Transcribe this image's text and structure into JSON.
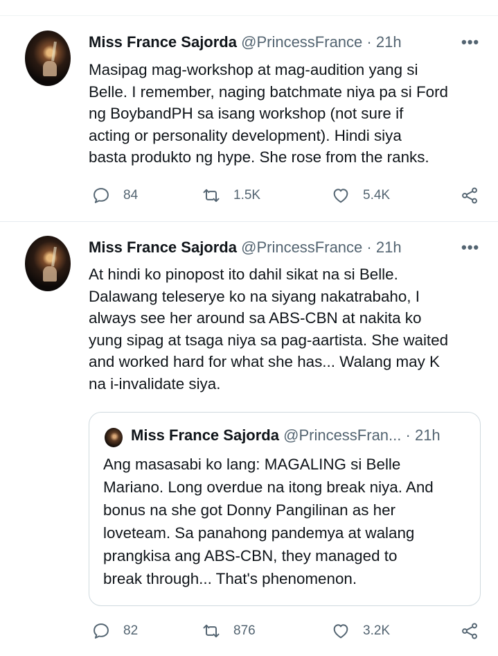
{
  "tweets": [
    {
      "author_name": "Miss France Sajorda",
      "handle": "@PrincessFrance",
      "separator": "·",
      "time": "21h",
      "more": "•••",
      "text_lines": [
        "Masipag mag-workshop at mag-audition yang si",
        "Belle. I remember, naging batchmate niya pa si Ford",
        "ng BoybandPH sa isang workshop (not sure if",
        "acting or personality development). Hindi siya",
        "basta produkto ng hype. She rose from the ranks."
      ],
      "replies": "84",
      "retweets": "1.5K",
      "likes": "5.4K"
    },
    {
      "author_name": "Miss France Sajorda",
      "handle": "@PrincessFrance",
      "separator": "·",
      "time": "21h",
      "more": "•••",
      "text_lines": [
        "At hindi ko pinopost ito dahil sikat na si Belle.",
        "Dalawang teleserye ko na siyang nakatrabaho, I",
        "always see her around sa ABS-CBN at nakita ko",
        "yung sipag at tsaga niya sa pag-aartista. She waited",
        "and worked hard for what she has... Walang may K",
        "na i-invalidate siya."
      ],
      "quoted": {
        "author_name": "Miss France Sajorda",
        "handle": "@PrincessFran...",
        "separator": "·",
        "time": "21h",
        "text_lines": [
          "Ang masasabi ko lang: MAGALING si Belle",
          "Mariano. Long overdue na itong break niya. And",
          "bonus na she got Donny Pangilinan as her",
          "loveteam. Sa panahong pandemya at walang",
          "prangkisa ang ABS-CBN, they managed to",
          "break through... That's phenomenon."
        ]
      },
      "replies": "82",
      "retweets": "876",
      "likes": "3.2K"
    }
  ],
  "icons": {
    "reply": "reply-icon",
    "retweet": "retweet-icon",
    "like": "heart-icon",
    "share": "share-icon",
    "more": "more-icon"
  },
  "colors": {
    "text": "#0f1419",
    "secondary": "#536471",
    "border": "#cfd9de"
  }
}
